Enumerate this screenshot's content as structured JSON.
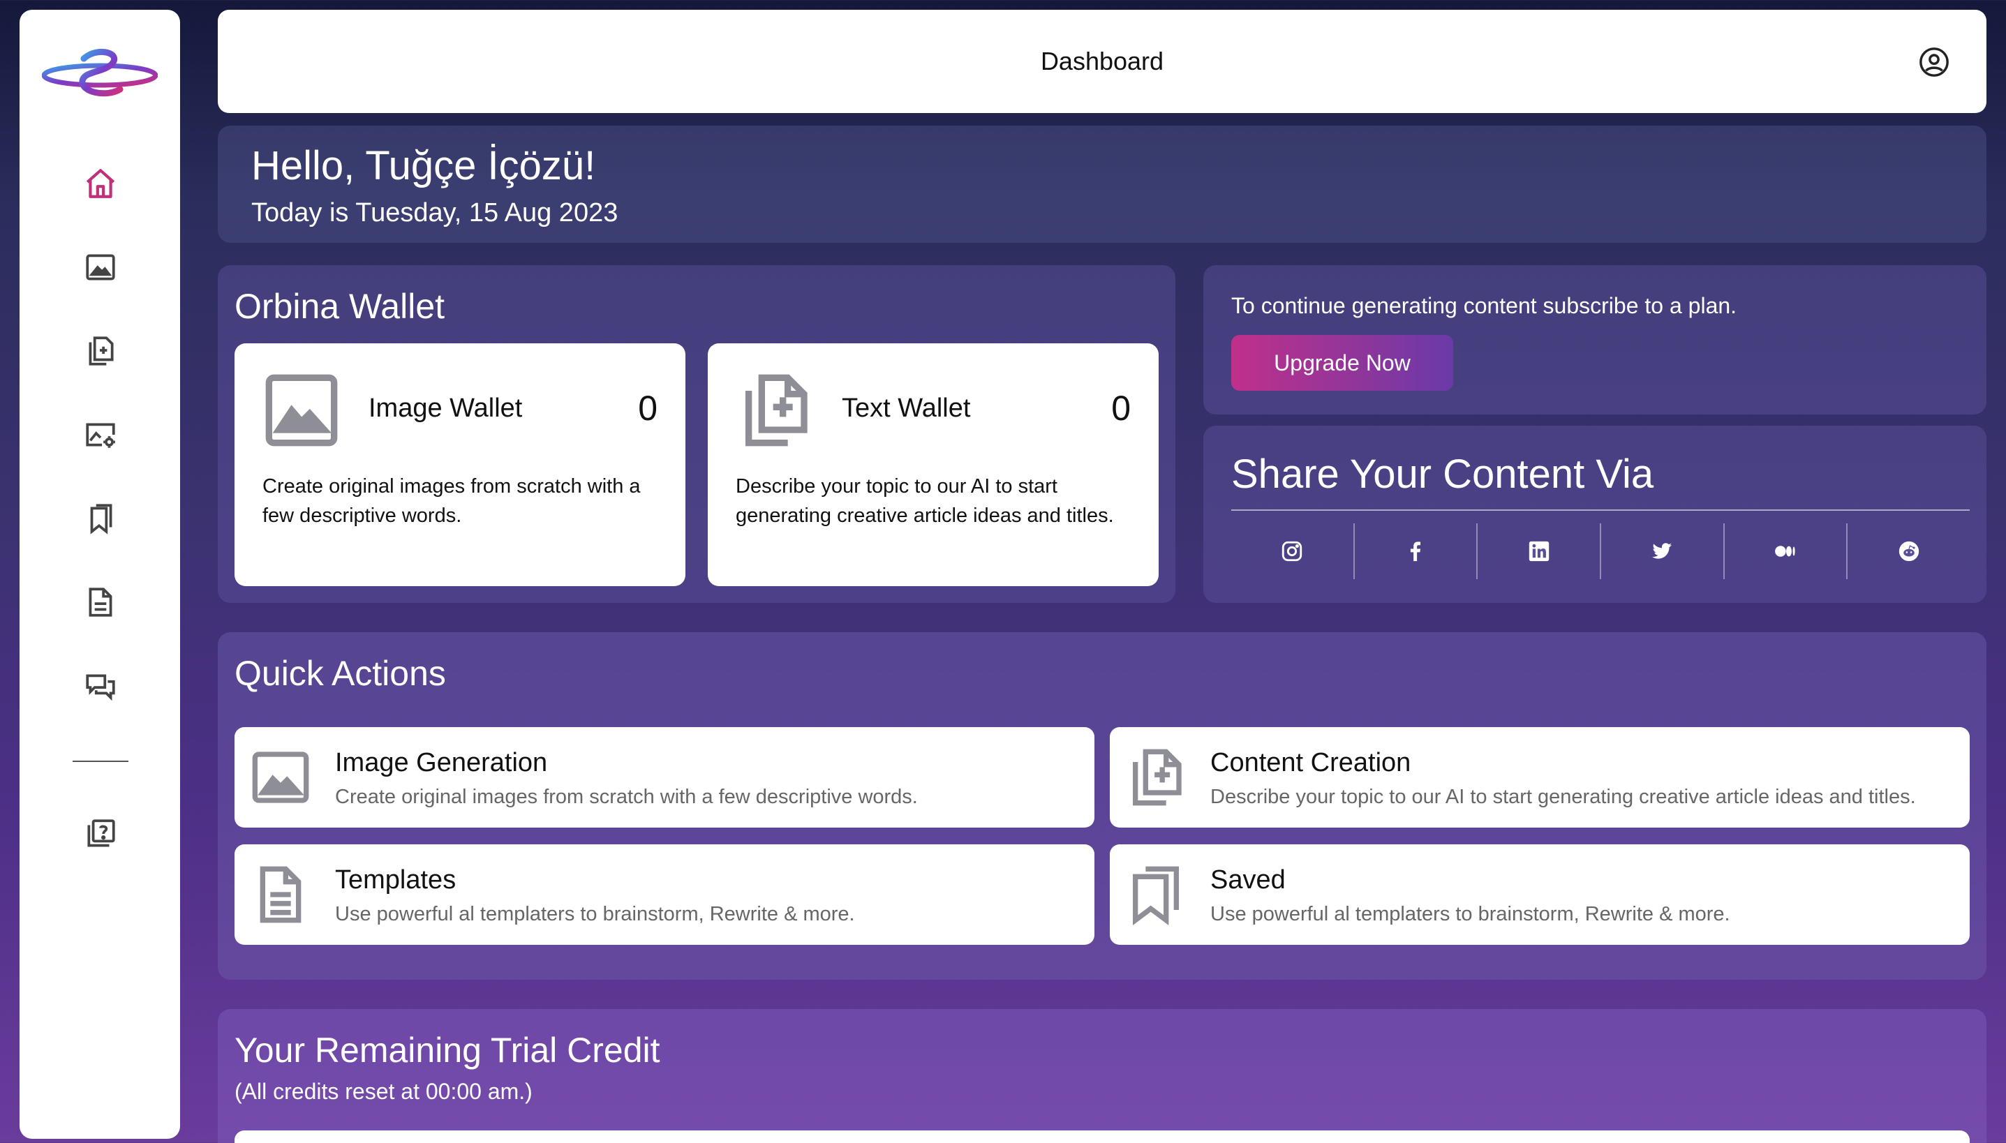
{
  "header": {
    "title": "Dashboard"
  },
  "greeting": {
    "title": "Hello, Tuğçe İçözü!",
    "date": "Today is Tuesday, 15 Aug 2023"
  },
  "wallet": {
    "title": "Orbina Wallet",
    "image": {
      "label": "Image Wallet",
      "count": "0",
      "desc": "Create original images from scratch with a few descriptive words."
    },
    "text": {
      "label": "Text Wallet",
      "count": "0",
      "desc": "Describe your topic to our AI to start generating creative article ideas and titles."
    }
  },
  "upgrade": {
    "message": "To continue generating content subscribe to a plan.",
    "button": "Upgrade Now"
  },
  "share": {
    "title": "Share Your Content Via",
    "icons": [
      "instagram-icon",
      "facebook-icon",
      "linkedin-icon",
      "twitter-icon",
      "medium-icon",
      "reddit-icon"
    ]
  },
  "quick": {
    "title": "Quick Actions",
    "items": [
      {
        "title": "Image Generation",
        "desc": "Create original images from scratch with a few descriptive words."
      },
      {
        "title": "Content Creation",
        "desc": "Describe your topic to our AI to start generating creative article ideas and titles."
      },
      {
        "title": "Templates",
        "desc": "Use powerful al templaters to brainstorm, Rewrite & more."
      },
      {
        "title": "Saved",
        "desc": "Use powerful al templaters to brainstorm, Rewrite & more."
      }
    ]
  },
  "trial": {
    "title": "Your Remaining Trial Credit",
    "note": "(All credits reset at 00:00 am.)"
  },
  "colors": {
    "accent": "#c0307a",
    "icon_gray": "#8e8e96",
    "nav_icon": "#444444"
  }
}
